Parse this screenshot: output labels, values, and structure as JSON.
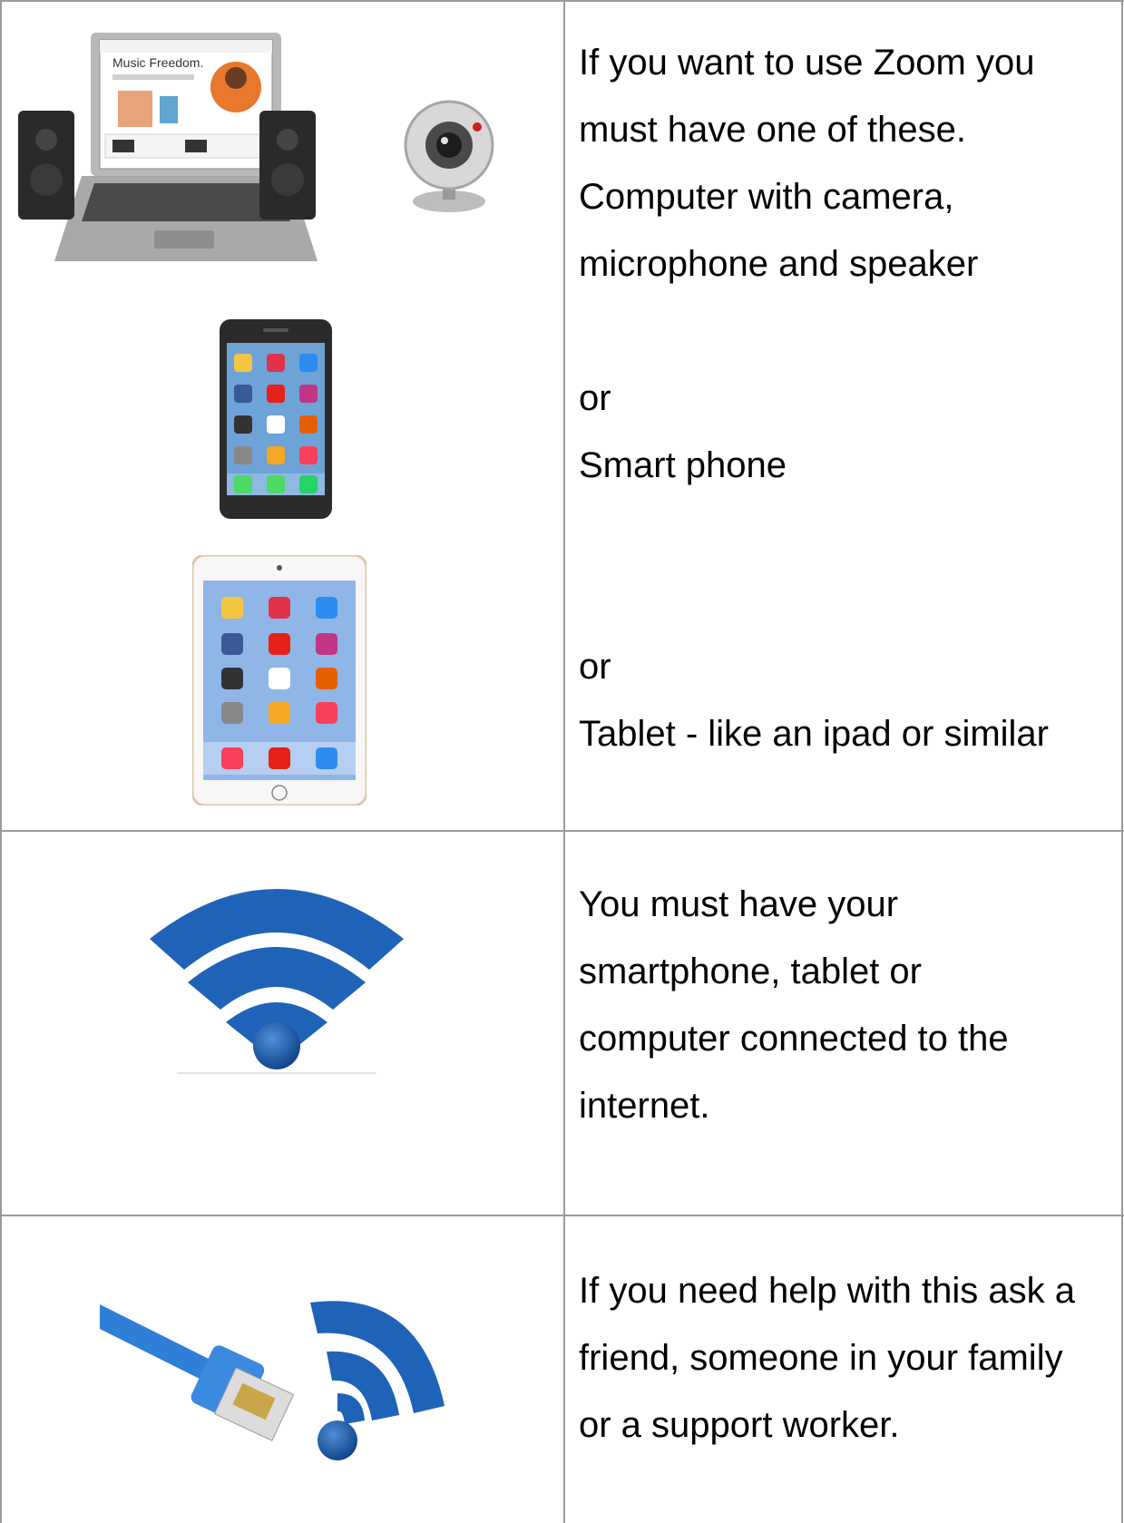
{
  "rows": [
    {
      "lines": [
        "If you want to use Zoom you",
        "must have one of these.",
        "Computer with camera,",
        "microphone and speaker",
        "",
        "or",
        "Smart phone",
        "",
        "",
        "or",
        "Tablet - like an ipad or similar"
      ],
      "laptop_screen_text": "Music Freedom."
    },
    {
      "lines": [
        "You must have your",
        "smartphone, tablet or",
        "computer connected to the",
        "internet."
      ]
    },
    {
      "lines": [
        "If you need help with this ask a",
        "friend, someone in your family",
        "or a support worker."
      ]
    }
  ],
  "colors": {
    "border": "#9a9a9a",
    "wifi_blue": "#1f63b8",
    "cable_blue": "#2f7fd8"
  },
  "icons": [
    "laptop-with-speakers-icon",
    "webcam-icon",
    "smartphone-icon",
    "tablet-icon",
    "wifi-icon",
    "ethernet-cable-icon"
  ]
}
